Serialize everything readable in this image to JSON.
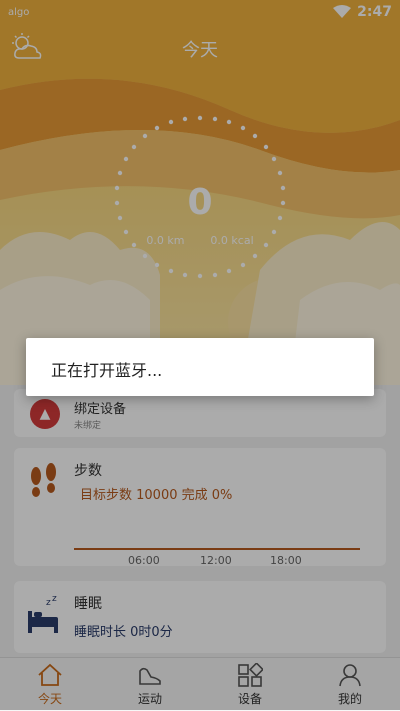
{
  "status_bar": {
    "left_label": "algo",
    "time": "2:47"
  },
  "header": {
    "title": "今天",
    "weather_icon": "weather-cloud-sun-icon"
  },
  "ring": {
    "count": "0",
    "distance": "0.0 km",
    "calories": "0.0 kcal"
  },
  "device_card": {
    "title": "绑定设备",
    "subtitle": "未绑定",
    "icon": "warning-icon"
  },
  "steps_card": {
    "title": "步数",
    "summary": "目标步数 10000 完成 0%",
    "ticks": [
      "06:00",
      "12:00",
      "18:00"
    ],
    "icon": "footprints-icon",
    "accent": "#b65a1e"
  },
  "sleep_card": {
    "title": "睡眠",
    "summary": "睡眠时长 0时0分",
    "icon": "bed-icon"
  },
  "dialog": {
    "message": "正在打开蓝牙..."
  },
  "nav": [
    {
      "label": "今天",
      "icon": "home-icon",
      "active": true
    },
    {
      "label": "运动",
      "icon": "shoe-icon",
      "active": false
    },
    {
      "label": "设备",
      "icon": "apps-icon",
      "active": false
    },
    {
      "label": "我的",
      "icon": "user-icon",
      "active": false
    }
  ],
  "colors": {
    "active": "#c86a1a",
    "hero_sky": "#f4c95a"
  }
}
